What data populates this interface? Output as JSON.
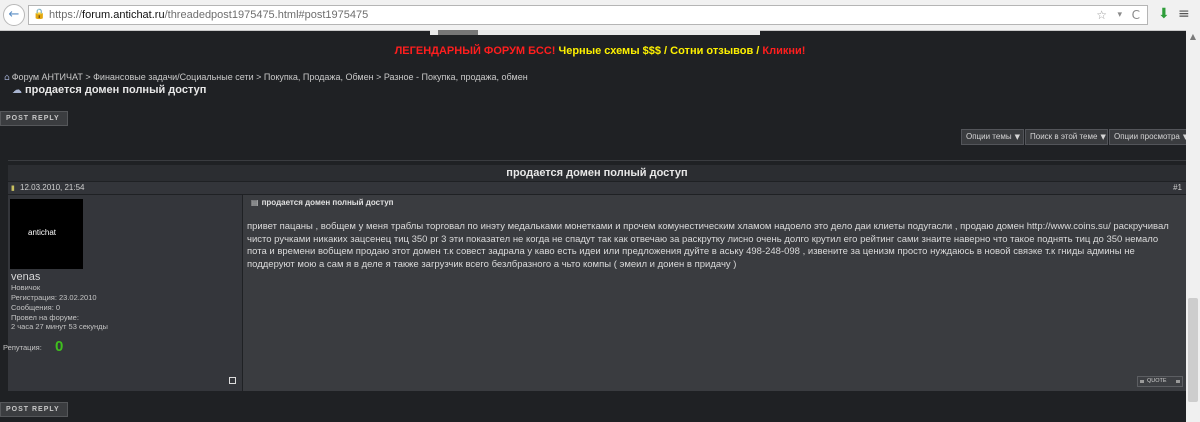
{
  "browser": {
    "url_scheme": "https://",
    "url_host": "forum.antichat.ru",
    "url_path": "/threadedpost1975475.html#post1975475",
    "back_glyph": "←",
    "lock_glyph": "🔒",
    "star_glyph": "☆",
    "dropdown_glyph": "▾",
    "reload_glyph": "C",
    "download_glyph": "⬇",
    "menu_glyph": "≡"
  },
  "ad": {
    "part1": "ЛЕГЕНДАРНЫЙ ФОРУМ БСС!",
    "part2": " Черные схемы $$$ / Сотни отзывов / ",
    "part3": "Кликни!"
  },
  "breadcrumb": {
    "home_glyph": "⌂",
    "text": "Форум АНТИЧАТ > Финансовые задачи/Социальные сети > Покупка, Продажа, Обмен > Разное - Покупка, продажа, обмен"
  },
  "thread": {
    "icon_glyph": "☁",
    "title": "продается домен полный доступ"
  },
  "buttons": {
    "post_reply": "POST REPLY",
    "options": [
      "Опции темы",
      "Поиск в этой теме",
      "Опции просмотра"
    ],
    "caret": "▼",
    "quote": "QUOTE"
  },
  "post": {
    "header_title": "продается домен полный доступ",
    "date": "12.03.2010, 21:54",
    "date_icon": "▮",
    "number": "#1",
    "title": "продается домен полный доступ",
    "doc_icon": "▤",
    "text": "привет пацаны , вобщем у меня траблы торговал по инэту медальками монетками и прочем комунестическим хламом надоело это дело даи клиеты подугасли , продаю домен http://www.coins.su/ раскручивал чисто ручками никаких зацсенец тиц 350 pr 3 эти показател не когда не спадут так как отвечаю за раскрутку лисно очень долго крутил его рейтинг сами знаите наверно что такое поднять тиц до 350 немало пота и времени вобщем продаю этот домен т.к совест задрала у каво есть идеи или предложения дуйте в аську 498-248-098 , извените за ценизм просто нуждаюсь в новой свяэке т.к гниды админы не поддеруют мою а сам я в деле я также загрузчик всего безлбразного а чьто компы ( эмеил и доиен в придачу )"
  },
  "user": {
    "avatar_text": "antichat",
    "name": "venas",
    "rank": "Новичок",
    "registration": "Регистрация: 23.02.2010",
    "messages": "Сообщения: 0",
    "online_label": "Провел на форуме:",
    "online_value": "2 часа 27 минут 53 секунды",
    "reputation_label": "Репутация:",
    "reputation_value": "0"
  },
  "scrollbar": {
    "up_glyph": "▲"
  }
}
